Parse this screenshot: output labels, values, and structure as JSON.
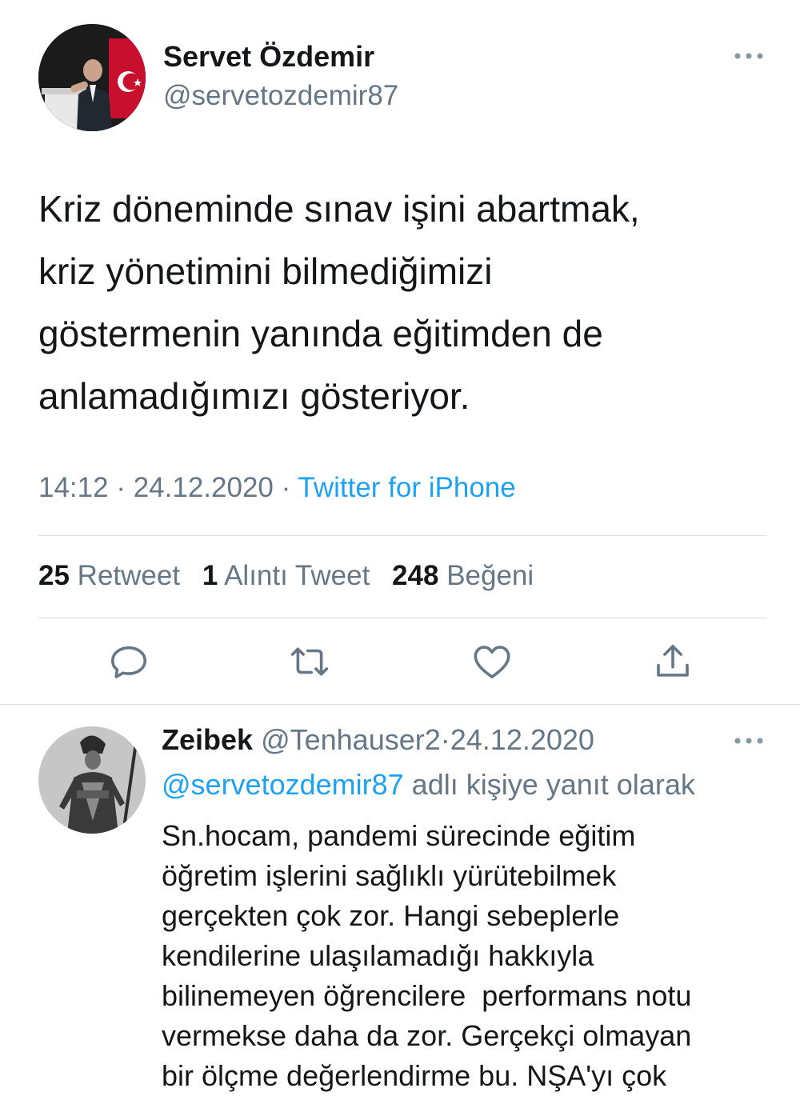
{
  "tweet": {
    "author": {
      "display_name": "Servet Özdemir",
      "handle": "@servetozdemir87",
      "avatar_icon": "user-avatar-photo"
    },
    "text": "Kriz döneminde sınav işini abartmak,\nkriz yönetimini bilmediğimizi\ngöstermenin yanında eğitimden de\nanlamadığımızı gösteriyor.",
    "time": "14:12",
    "date": "24.12.2020",
    "separator": "·",
    "source": "Twitter for iPhone",
    "stats": {
      "retweets_count": "25",
      "retweets_label": "Retweet",
      "quotes_count": "1",
      "quotes_label": "Alıntı Tweet",
      "likes_count": "248",
      "likes_label": "Beğeni"
    },
    "actions": [
      "reply-icon",
      "retweet-icon",
      "like-icon",
      "share-icon"
    ],
    "more_icon": "more-horizontal-icon"
  },
  "reply": {
    "display_name": "Zeibek",
    "handle": "@Tenhauser2",
    "separator": "·",
    "date": "24.12.2020",
    "reply_to_mention": "@servetozdemir87",
    "reply_to_suffix": " adlı kişiye yanıt olarak",
    "text": "Sn.hocam, pandemi sürecinde eğitim\nöğretim işlerini sağlıklı yürütebilmek\ngerçekten çok zor. Hangi sebeplerle\nkendilerine ulaşılamadığı hakkıyla\nbilinemeyen öğrencilere  performans notu\nvermekse daha da zor. Gerçekçi olmayan\nbir ölçme değerlendirme bu. NŞA'yı çok"
  },
  "colors": {
    "accent": "#1da1f2",
    "secondary_text": "#657786",
    "primary_text": "#14171a",
    "divider": "#d7dde2"
  }
}
